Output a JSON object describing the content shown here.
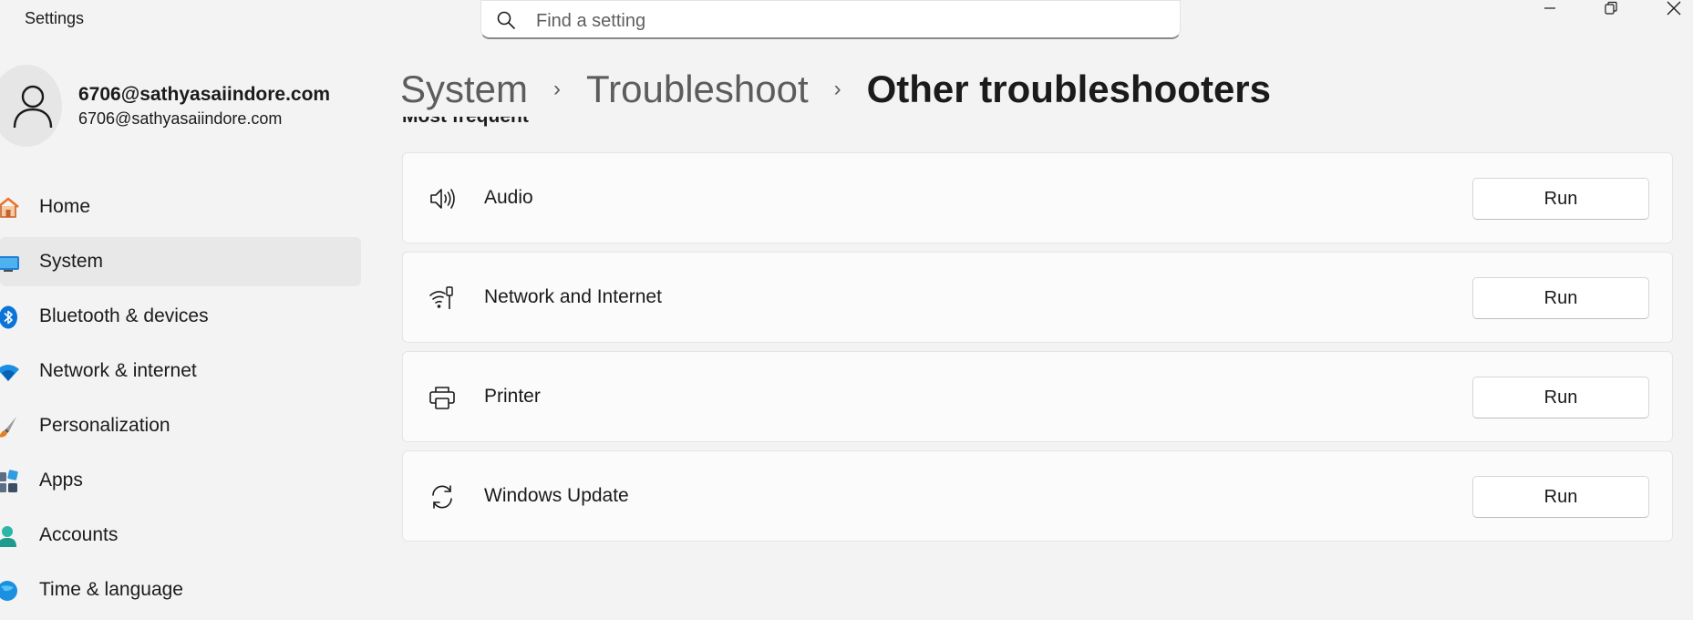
{
  "window": {
    "title": "Settings"
  },
  "search": {
    "placeholder": "Find a setting",
    "icon": "search-icon"
  },
  "profile": {
    "name": "6706@sathyasaiindore.com",
    "email": "6706@sathyasaiindore.com"
  },
  "sidebar": {
    "items": [
      {
        "label": "Home",
        "icon": "home-icon",
        "selected": false
      },
      {
        "label": "System",
        "icon": "system-icon",
        "selected": true
      },
      {
        "label": "Bluetooth & devices",
        "icon": "bluetooth-icon",
        "selected": false
      },
      {
        "label": "Network & internet",
        "icon": "wifi-icon",
        "selected": false
      },
      {
        "label": "Personalization",
        "icon": "brush-icon",
        "selected": false
      },
      {
        "label": "Apps",
        "icon": "apps-icon",
        "selected": false
      },
      {
        "label": "Accounts",
        "icon": "accounts-icon",
        "selected": false
      },
      {
        "label": "Time & language",
        "icon": "globe-icon",
        "selected": false
      }
    ]
  },
  "breadcrumb": {
    "items": [
      "System",
      "Troubleshoot",
      "Other troubleshooters"
    ],
    "separator": "›"
  },
  "section": {
    "title": "Most frequent"
  },
  "troubleshooters": [
    {
      "label": "Audio",
      "icon": "speaker-icon",
      "button": "Run"
    },
    {
      "label": "Network and Internet",
      "icon": "network-icon",
      "button": "Run"
    },
    {
      "label": "Printer",
      "icon": "printer-icon",
      "button": "Run"
    },
    {
      "label": "Windows Update",
      "icon": "sync-icon",
      "button": "Run"
    }
  ],
  "colors": {
    "background": "#f3f3f3",
    "card": "#fbfbfb",
    "selected": "#e8e8e8",
    "accent": "#0067c0"
  }
}
